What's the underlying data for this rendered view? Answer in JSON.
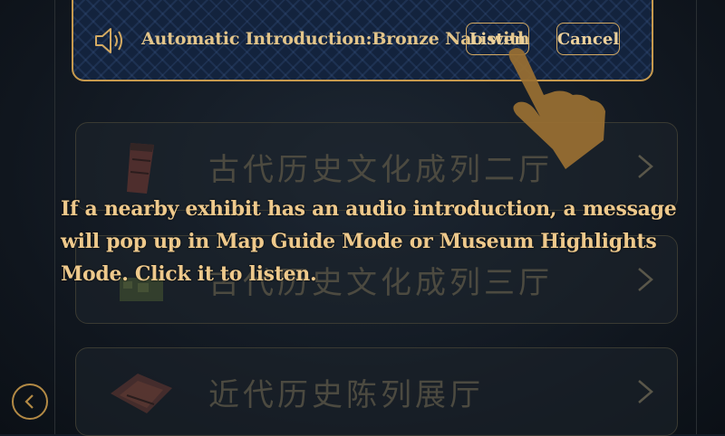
{
  "banner": {
    "speaker_icon": "speaker-icon",
    "message": "Automatic Introduction:Bronze Nao with",
    "listen_label": "Listen",
    "cancel_label": "Cancel",
    "accent_color": "#d4aa62",
    "background_color": "#13233d"
  },
  "halls": [
    {
      "title": "古代历史文化成列二厅",
      "thumb_icon": "red-stone-artifact-icon"
    },
    {
      "title": "古代历史文化成列三厅",
      "thumb_icon": "green-tile-artifact-icon"
    },
    {
      "title": "近代历史陈列展厅",
      "thumb_icon": "red-roof-building-icon"
    }
  ],
  "tutorial": {
    "text": "If a nearby exhibit has an audio introduction, a message will pop up in Map Guide Mode or Museum Highlights Mode. Click it to listen.",
    "color": "#eec98c"
  },
  "navigation": {
    "back_icon": "back-arrow-icon"
  },
  "overlay": {
    "hand_icon": "pointing-hand-icon"
  }
}
